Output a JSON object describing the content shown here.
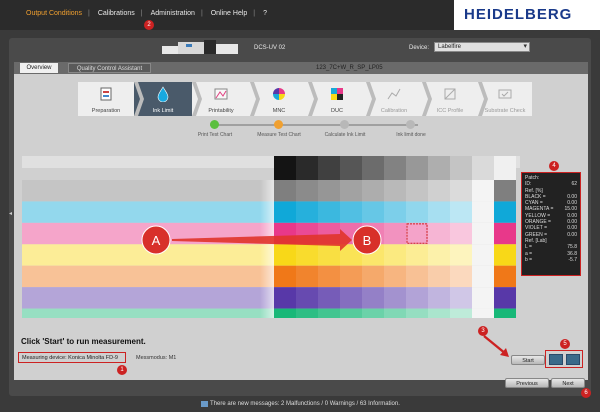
{
  "nav": {
    "items": [
      "Output Conditions",
      "Calibrations",
      "Administration",
      "Online Help",
      "?"
    ],
    "active": 0
  },
  "brand": {
    "logo": "HEIDELBERG",
    "color": "#1a3a8a"
  },
  "header": {
    "device_model": "DCS-UV 02",
    "device_label": "Device:",
    "device_value": "Labelfire"
  },
  "tabs": [
    "Overview",
    "Quality Control Assistant"
  ],
  "job_name": "123_7C+W_R_SP_LP05",
  "workflow": {
    "steps": [
      {
        "label": "Preparation",
        "icon": "preparation-icon",
        "state": "done"
      },
      {
        "label": "Ink Limit",
        "icon": "ink-drop-icon",
        "state": "active"
      },
      {
        "label": "Printability",
        "icon": "printability-icon",
        "state": "done"
      },
      {
        "label": "MNC",
        "icon": "mnc-icon",
        "state": "done"
      },
      {
        "label": "DUC",
        "icon": "duc-icon",
        "state": "done"
      },
      {
        "label": "Calibration",
        "icon": "calibration-icon",
        "state": "disabled"
      },
      {
        "label": "ICC Profile",
        "icon": "icc-profile-icon",
        "state": "disabled"
      },
      {
        "label": "Substrate Check",
        "icon": "substrate-check-icon",
        "state": "disabled"
      }
    ]
  },
  "progress": {
    "steps": [
      {
        "label": "Print Test Chart",
        "color": "#5cbf3f"
      },
      {
        "label": "Measure Test Chart",
        "color": "#f0a030"
      },
      {
        "label": "Calculate Ink Limit",
        "color": "#b8b8b8"
      },
      {
        "label": "Ink limit done",
        "color": "#b8b8b8"
      }
    ]
  },
  "patches": {
    "colors": [
      "#7f7f7f",
      "#10a8d8",
      "#e8388a",
      "#f8d818",
      "#f07818",
      "#5838a8",
      "#18b878"
    ],
    "annotations": [
      "A",
      "B"
    ],
    "selected_row": 2,
    "selected_col": 6
  },
  "info": {
    "patch_label": "Patch:",
    "rows": [
      {
        "k": "ID:",
        "v": "62"
      },
      {
        "k": "Ref. [%]",
        "v": ""
      },
      {
        "k": "BLACK =",
        "v": "0.00"
      },
      {
        "k": "CYAN =",
        "v": "0.00"
      },
      {
        "k": "MAGENTA =",
        "v": "15.00"
      },
      {
        "k": "YELLOW =",
        "v": "0.00"
      },
      {
        "k": "ORANGE =",
        "v": "0.00"
      },
      {
        "k": "VIOLET =",
        "v": "0.00"
      },
      {
        "k": "GREEN =",
        "v": "0.00"
      },
      {
        "k": "Ref. [Lab]",
        "v": ""
      },
      {
        "k": "L =",
        "v": "75.8"
      },
      {
        "k": "a =",
        "v": "36.8"
      },
      {
        "k": "b =",
        "v": "-5.7"
      }
    ]
  },
  "instruction": "Click 'Start' to run measurement.",
  "measuring_device": "Measuring device: Konica Minolta FD-9",
  "messmodus": "Messmodus: M1",
  "buttons": {
    "start": "Start",
    "previous": "Previous",
    "next": "Next"
  },
  "badges": [
    "1",
    "2",
    "3",
    "4",
    "5",
    "6"
  ],
  "footer": {
    "messages": "There are new messages: 2 Malfunctions / 0 Warnings / 63 Information."
  },
  "colors": {
    "accent": "#f0a030",
    "highlight": "#cc2222",
    "active_step": "#4a5a6a"
  }
}
